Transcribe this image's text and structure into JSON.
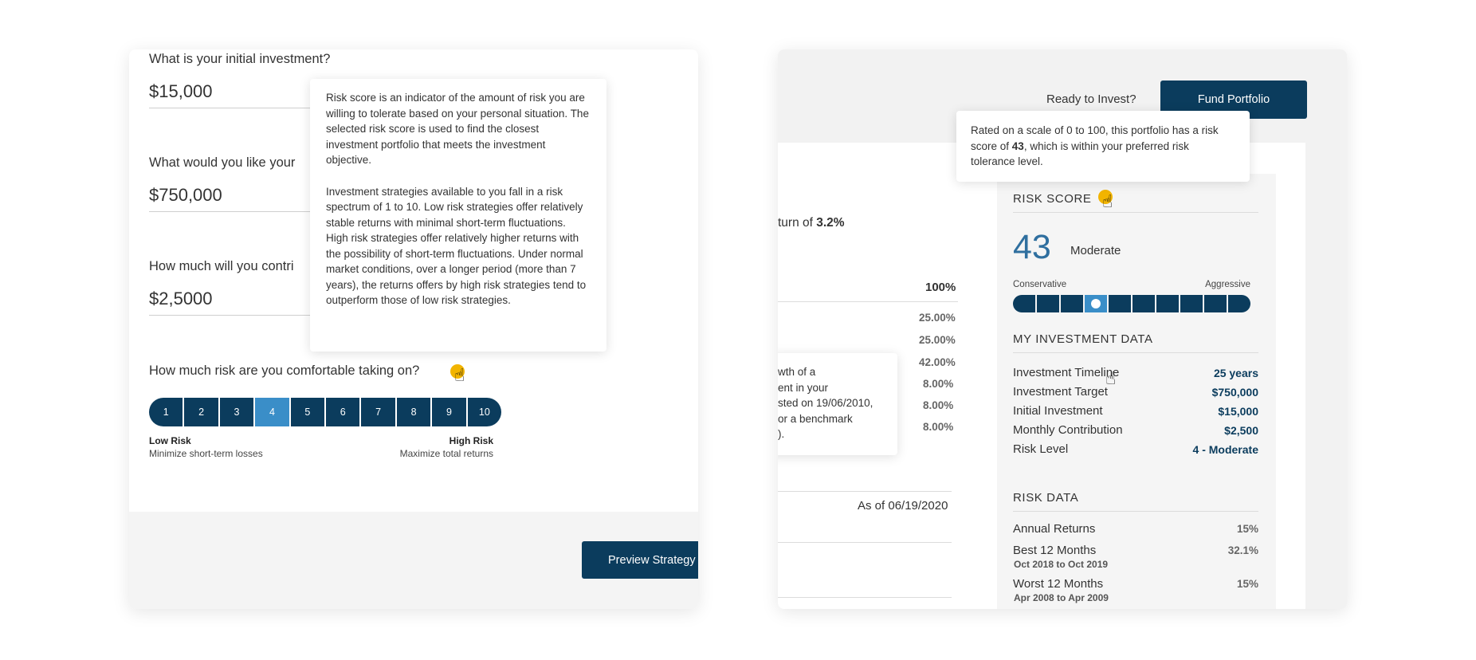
{
  "left": {
    "q1": {
      "label": "What is your initial investment?",
      "value": "$15,000"
    },
    "q2": {
      "label": "What would you like your",
      "value": "$750,000"
    },
    "q3": {
      "label": "How much will you contri",
      "value": "$2,5000"
    },
    "risk_question": "How much risk are you comfortable taking on?",
    "risk_levels": [
      "1",
      "2",
      "3",
      "4",
      "5",
      "6",
      "7",
      "8",
      "9",
      "10"
    ],
    "selected_risk": 4,
    "low_title": "Low Risk",
    "low_sub": "Minimize short-term losses",
    "high_title": "High Risk",
    "high_sub": "Maximize total returns",
    "preview_button": "Preview Strategy",
    "tooltip": {
      "p1": "Risk score is an indicator of the amount of risk you are willing to tolerate based on your personal situation. The selected risk score is used to find the closest investment portfolio that meets the investment objective.",
      "p2": "Investment strategies available to you fall in a risk spectrum of 1 to 10. Low risk strategies offer relatively stable returns with minimal short-term fluctuations. High risk strategies offer relatively higher returns with the possibility of short-term fluctuations. Under normal market conditions, over a longer period (more than 7 years), the returns offers by high risk strategies tend to outperform those of low risk strategies."
    }
  },
  "right": {
    "ready_text": "Ready to Invest?",
    "fund_button": "Fund Portfolio",
    "tooltip": {
      "pre": "Rated on a scale of 0 to 100, this portfolio has a risk score of ",
      "score": "43",
      "post": ", which is within your preferred risk tolerance level."
    },
    "return_pre": "turn of ",
    "return_val": "3.2%",
    "total_pct": "100%",
    "allocations": [
      "25.00%",
      "25.00%",
      "42.00%",
      "8.00%",
      "8.00%",
      "8.00%"
    ],
    "growth_tooltip": [
      "wth of a",
      "ent in your",
      "sted on 19/06/2010,",
      "or a benchmark",
      ")."
    ],
    "as_of": "As of 06/19/2020",
    "risk_score_title": "RISK SCORE",
    "risk_score": "43",
    "risk_label": "Moderate",
    "conservative": "Conservative",
    "aggressive": "Aggressive",
    "score_segments": 10,
    "score_active_index": 3,
    "my_data_title": "MY INVESTMENT DATA",
    "my_data": [
      {
        "k": "Investment Timeline",
        "v": "25 years"
      },
      {
        "k": "Investment Target",
        "v": "$750,000"
      },
      {
        "k": "Initial Investment",
        "v": "$15,000"
      },
      {
        "k": "Monthly Contribution",
        "v": "$2,500"
      },
      {
        "k": "Risk Level",
        "v": "4 - Moderate"
      }
    ],
    "risk_data_title": "RISK DATA",
    "annual_returns": {
      "k": "Annual Returns",
      "v": "15%"
    },
    "best": {
      "k": "Best 12 Months",
      "v": "32.1%",
      "sub": "Oct 2018 to Oct 2019"
    },
    "worst": {
      "k": "Worst 12 Months",
      "v": "15%",
      "sub": "Apr 2008 to Apr 2009"
    }
  },
  "colors": {
    "primary": "#0b3c5d",
    "active": "#3a8ec8",
    "help": "#f2b400"
  }
}
